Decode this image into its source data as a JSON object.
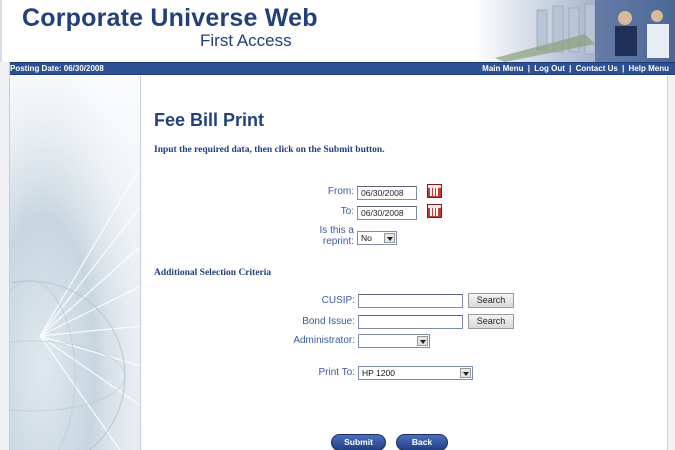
{
  "header": {
    "brand_title": "Corporate Universe Web",
    "brand_sub": "First Access"
  },
  "navbar": {
    "posting_date": "Posting Date: 06/30/2008",
    "links": [
      "Main Menu",
      "Log Out",
      "Contact Us",
      "Help Menu"
    ],
    "separator": "|"
  },
  "main": {
    "title": "Fee Bill Print",
    "instructions": "Input the required data, then click on the Submit button.",
    "from_label": "From:",
    "from_value": "06/30/2008",
    "to_label": "To:",
    "to_value": "06/30/2008",
    "reprint_label_1": "Is this a",
    "reprint_label_2": "reprint:",
    "reprint_value": "No",
    "section_title": "Additional Selection Criteria",
    "cusip_label": "CUSIP:",
    "cusip_value": "",
    "bond_label": "Bond Issue:",
    "bond_value": "",
    "admin_label": "Administrator:",
    "admin_value": "",
    "print_label": "Print To:",
    "print_value": "HP 1200",
    "search_label": "Search",
    "submit_label": "Submit",
    "back_label": "Back"
  },
  "icons": {
    "calendar": "calendar-icon",
    "dropdown": "chevron-down-icon"
  },
  "colors": {
    "brand": "#23407a",
    "navbar": "#2d4f93",
    "label": "#3c5a9a",
    "calendar": "#c23a33"
  }
}
